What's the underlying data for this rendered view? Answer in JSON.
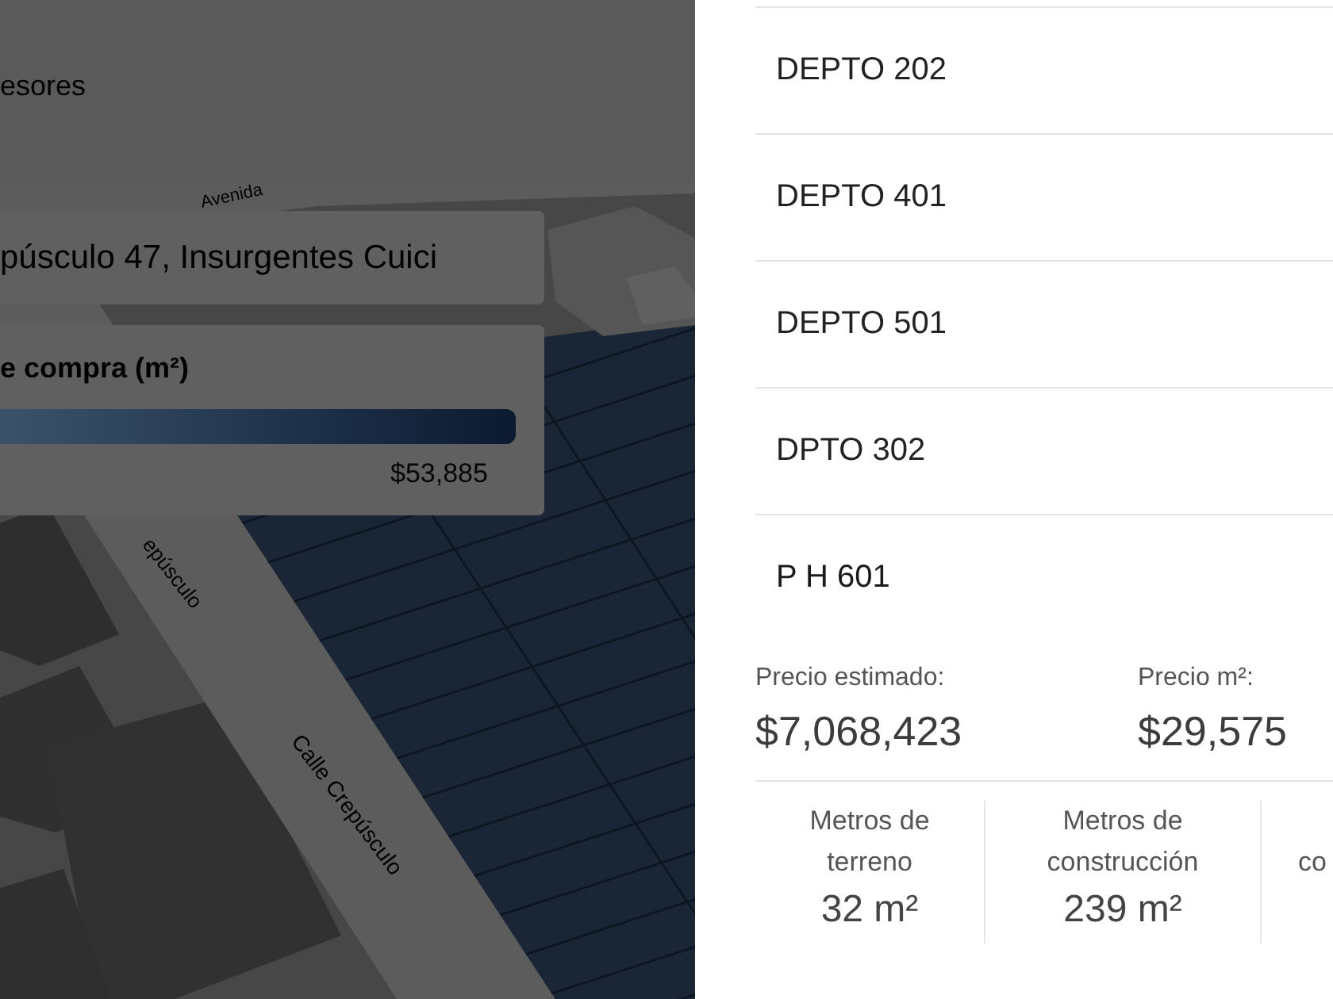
{
  "header": {
    "nav_link": "esores"
  },
  "map": {
    "street_labels": [
      {
        "text": "Avenida"
      },
      {
        "text": "epúsculo"
      },
      {
        "text": "Calle Crepúsculo"
      }
    ]
  },
  "address_field": {
    "value": "púsculo 47, Insurgentes Cuici"
  },
  "legend": {
    "title": "e compra (m²)",
    "max_label": "$53,885"
  },
  "units": [
    {
      "name": "DEPTO 202",
      "expanded": false
    },
    {
      "name": "DEPTO 401",
      "expanded": false
    },
    {
      "name": "DEPTO 501",
      "expanded": false
    },
    {
      "name": "DPTO 302",
      "expanded": false
    },
    {
      "name": "P H 601",
      "expanded": true,
      "details": {
        "prices": [
          {
            "label": "Precio estimado:",
            "value": "$7,068,423"
          },
          {
            "label": "Precio m²:",
            "value": "$29,575"
          }
        ],
        "stats": [
          {
            "label": "Metros de terreno",
            "value": "32 m²"
          },
          {
            "label": "Metros de construcción",
            "value": "239 m²"
          },
          {
            "label": "co"
          }
        ]
      }
    }
  ]
}
